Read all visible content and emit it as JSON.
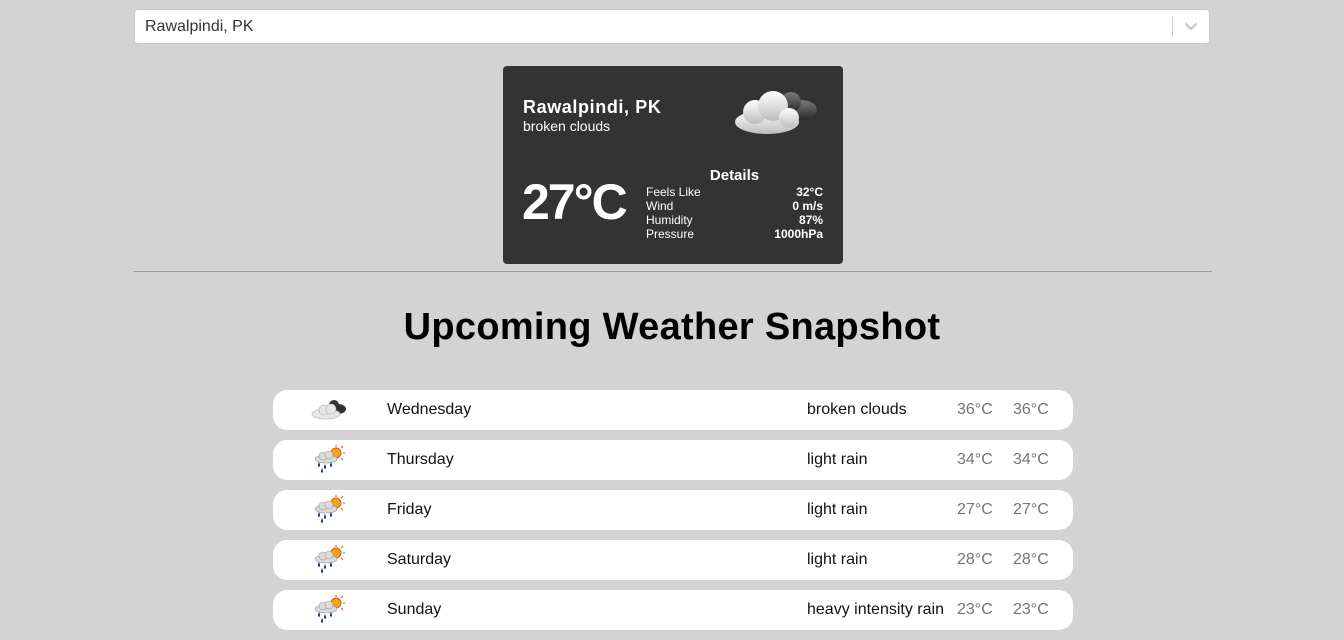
{
  "search": {
    "value": "Rawalpindi, PK"
  },
  "current": {
    "city": "Rawalpindi, PK",
    "description": "broken clouds",
    "icon": "broken-clouds-icon",
    "temperature": "27°C",
    "details_title": "Details",
    "details": [
      {
        "label": "Feels Like",
        "value": "32°C"
      },
      {
        "label": "Wind",
        "value": "0 m/s"
      },
      {
        "label": "Humidity",
        "value": "87%"
      },
      {
        "label": "Pressure",
        "value": "1000hPa"
      }
    ]
  },
  "forecast": {
    "title": "Upcoming Weather Snapshot",
    "days": [
      {
        "icon": "broken-clouds-icon",
        "day": "Wednesday",
        "description": "broken clouds",
        "min": "36°C",
        "max": "36°C"
      },
      {
        "icon": "light-rain-icon",
        "day": "Thursday",
        "description": "light rain",
        "min": "34°C",
        "max": "34°C"
      },
      {
        "icon": "light-rain-icon",
        "day": "Friday",
        "description": "light rain",
        "min": "27°C",
        "max": "27°C"
      },
      {
        "icon": "light-rain-icon",
        "day": "Saturday",
        "description": "light rain",
        "min": "28°C",
        "max": "28°C"
      },
      {
        "icon": "light-rain-icon",
        "day": "Sunday",
        "description": "heavy intensity rain",
        "min": "23°C",
        "max": "23°C"
      }
    ]
  },
  "colors": {
    "background": "#d3d3d3",
    "card": "#333333",
    "row": "#ffffff",
    "muted_temp": "#757575"
  }
}
